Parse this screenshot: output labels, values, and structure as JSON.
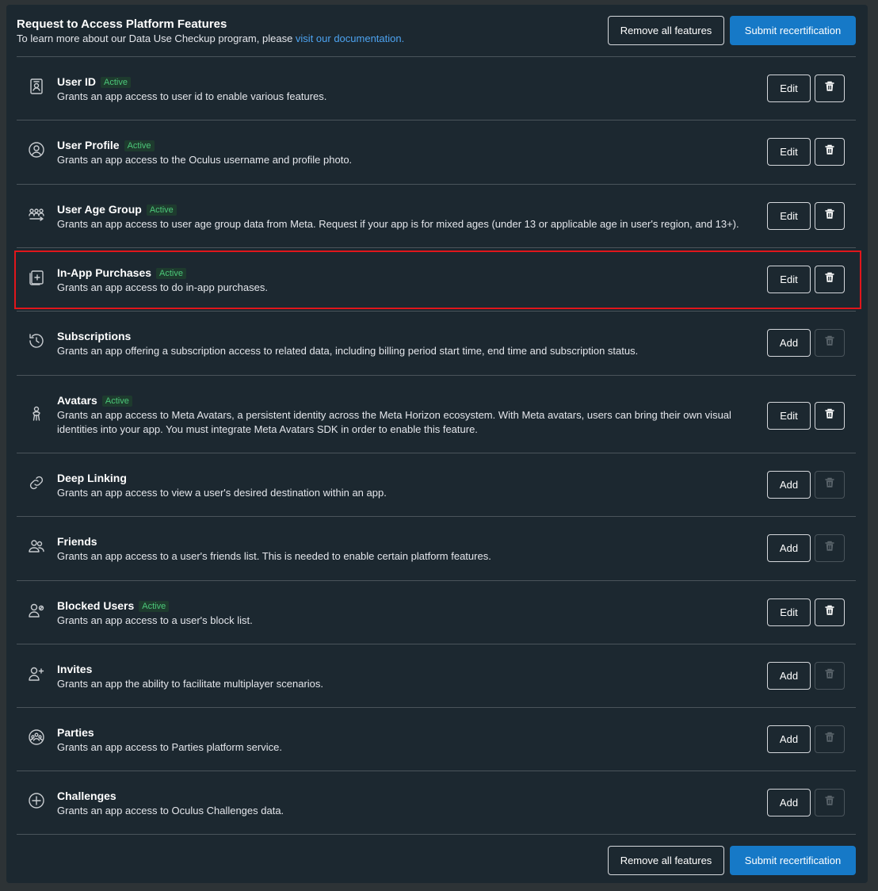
{
  "header": {
    "title": "Request to Access Platform Features",
    "subtitle_prefix": "To learn more about our Data Use Checkup program, please ",
    "subtitle_link": "visit our documentation."
  },
  "buttons": {
    "remove_all": "Remove all features",
    "submit": "Submit recertification"
  },
  "colors": {
    "accent": "#1679c7",
    "active_badge": "#4cc779",
    "highlight_border": "#e0161b"
  },
  "features": [
    {
      "name": "User ID",
      "active": true,
      "badge": "Active",
      "description": "Grants an app access to user id to enable various features.",
      "action": "Edit",
      "icon": "id-card-icon"
    },
    {
      "name": "User Profile",
      "active": true,
      "badge": "Active",
      "description": "Grants an app access to the Oculus username and profile photo.",
      "action": "Edit",
      "icon": "user-circle-icon"
    },
    {
      "name": "User Age Group",
      "active": true,
      "badge": "Active",
      "description": "Grants an app access to user age group data from Meta. Request if your app is for mixed ages (under 13 or applicable age in user's region, and 13+).",
      "action": "Edit",
      "icon": "group-arrows-icon"
    },
    {
      "name": "In-App Purchases",
      "active": true,
      "badge": "Active",
      "description": "Grants an app access to do in-app purchases.",
      "action": "Edit",
      "icon": "card-plus-icon"
    },
    {
      "name": "Subscriptions",
      "active": false,
      "badge": "",
      "description": "Grants an app offering a subscription access to related data, including billing period start time, end time and subscription status.",
      "action": "Add",
      "icon": "history-icon"
    },
    {
      "name": "Avatars",
      "active": true,
      "badge": "Active",
      "description": "Grants an app access to Meta Avatars, a persistent identity across the Meta Horizon ecosystem. With Meta avatars, users can bring their own visual identities into your app. You must integrate Meta Avatars SDK in order to enable this feature.",
      "action": "Edit",
      "icon": "avatar-icon"
    },
    {
      "name": "Deep Linking",
      "active": false,
      "badge": "",
      "description": "Grants an app access to view a user's desired destination within an app.",
      "action": "Add",
      "icon": "link-icon"
    },
    {
      "name": "Friends",
      "active": false,
      "badge": "",
      "description": "Grants an app access to a user's friends list. This is needed to enable certain platform features.",
      "action": "Add",
      "icon": "friends-icon"
    },
    {
      "name": "Blocked Users",
      "active": true,
      "badge": "Active",
      "description": "Grants an app access to a user's block list.",
      "action": "Edit",
      "icon": "user-blocked-icon"
    },
    {
      "name": "Invites",
      "active": false,
      "badge": "",
      "description": "Grants an app the ability to facilitate multiplayer scenarios.",
      "action": "Add",
      "icon": "user-plus-icon"
    },
    {
      "name": "Parties",
      "active": false,
      "badge": "",
      "description": "Grants an app access to Parties platform service.",
      "action": "Add",
      "icon": "party-icon"
    },
    {
      "name": "Challenges",
      "active": false,
      "badge": "",
      "description": "Grants an app access to Oculus Challenges data.",
      "action": "Add",
      "icon": "plus-circle-icon"
    }
  ]
}
